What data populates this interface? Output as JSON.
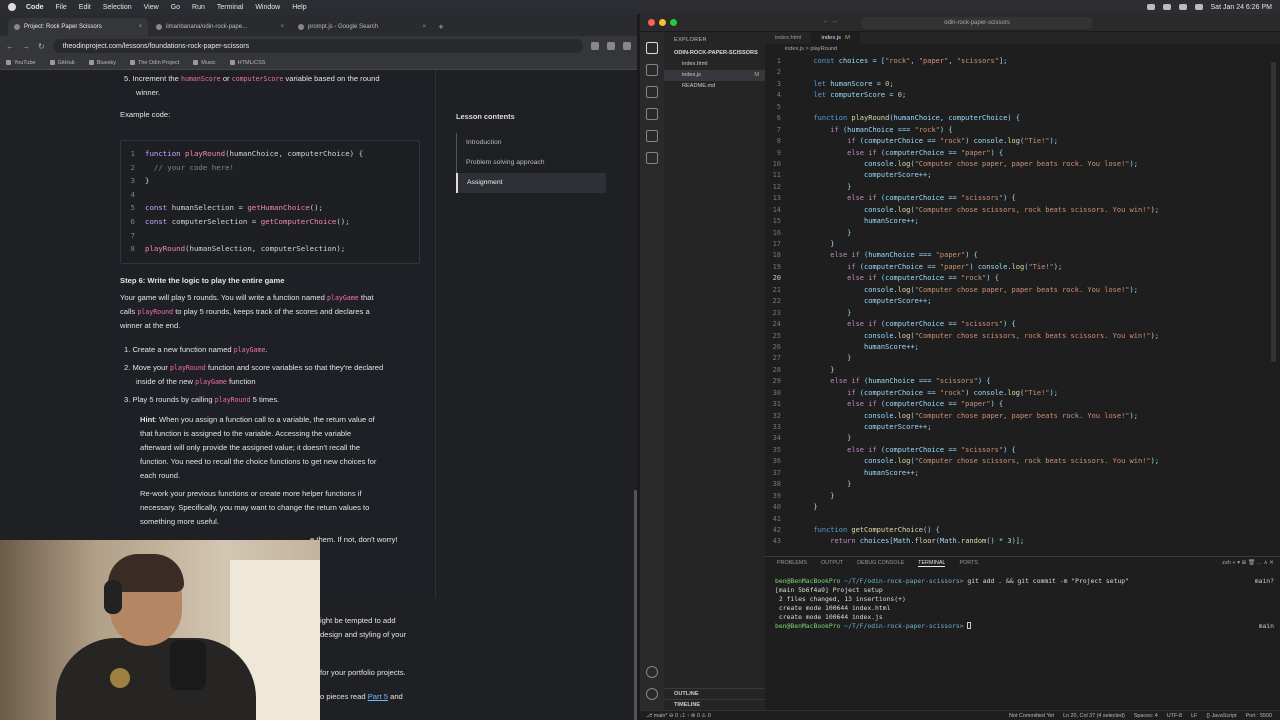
{
  "menubar": {
    "app": "Code",
    "items": [
      "File",
      "Edit",
      "Selection",
      "View",
      "Go",
      "Run",
      "Terminal",
      "Window",
      "Help"
    ],
    "clock": "Sat Jan 24  6:26 PM"
  },
  "browser": {
    "tabs": [
      {
        "label": "Project: Rock Paper Scissors"
      },
      {
        "label": "ilmanbanana/odin-rock-pape..."
      },
      {
        "label": "prompt.js - Google Search"
      }
    ],
    "new_tab": "+",
    "url": "theodinproject.com/lessons/foundations-rock-paper-scissors",
    "bookmarks": [
      "YouTube",
      "GitHub",
      "Bluesky",
      "The Odin Project",
      "Music",
      "HTML/CSS"
    ]
  },
  "article": {
    "step5_item": "5.  Increment the",
    "human_score": "humanScore",
    "or": "or",
    "computer_score": "computerScore",
    "variable_tail": "variable based on the round",
    "winner": "winner.",
    "example_code": "Example code:",
    "code": [
      {
        "n": "1",
        "t": [
          [
            "kw",
            "function "
          ],
          [
            "fn",
            "playRound"
          ],
          [
            "",
            "(humanChoice, computerChoice) {"
          ]
        ]
      },
      {
        "n": "2",
        "t": [
          [
            "cm",
            "  // your code here!"
          ]
        ]
      },
      {
        "n": "3",
        "t": [
          [
            "",
            "}"
          ]
        ]
      },
      {
        "n": "4",
        "t": [
          [
            "",
            ""
          ]
        ]
      },
      {
        "n": "5",
        "t": [
          [
            "kw",
            "const "
          ],
          [
            "",
            "humanSelection = "
          ],
          [
            "fn",
            "getHumanChoice"
          ],
          [
            "",
            "();"
          ]
        ]
      },
      {
        "n": "6",
        "t": [
          [
            "kw",
            "const "
          ],
          [
            "",
            "computerSelection = "
          ],
          [
            "fn",
            "getComputerChoice"
          ],
          [
            "",
            "();"
          ]
        ]
      },
      {
        "n": "7",
        "t": [
          [
            "",
            ""
          ]
        ]
      },
      {
        "n": "8",
        "t": [
          [
            "fn",
            "playRound"
          ],
          [
            "",
            "(humanSelection, computerSelection);"
          ]
        ]
      }
    ],
    "step6": "Step 6: Write the logic to play the entire game",
    "p1a": "Your game will play 5 rounds. You will write a function named",
    "playGame": "playGame",
    "p1b": "that",
    "p1c": "calls",
    "playRound": "playRound",
    "p1d": "to play 5 rounds, keeps track of the scores and declares a",
    "p1e": "winner at the end.",
    "li1a": "1.  Create a new function named",
    "li1b": ".",
    "li2a": "2.  Move your",
    "li2b": "function and score variables so that they're declared",
    "li2c": "inside of the new",
    "li2d": "function",
    "li3a": "3.  Play 5 rounds by calling",
    "li3b": "5 times.",
    "hint_label": "Hint",
    "hint1": ": When you assign a function call to a variable, the return value of",
    "hint2": "that function is assigned to the variable. Accessing the variable",
    "hint3": "afterward will only provide the assigned value; it doesn't recall the",
    "hint4": "function. You need to recall the choice functions to get new choices for",
    "hint5": "each round.",
    "rework1": "Re-work your previous functions or create more helper functions if",
    "rework2": "necessary. Specifically, you may want to change the return values to",
    "rework3": "something more useful.",
    "partial1": "e them. If not, don't worry!",
    "partial2": "ight be tempted to add",
    "partial3": "design and styling of your",
    "partial4": "for your portfolio projects.",
    "partial5": "o pieces read",
    "part5": "Part 5",
    "and": "and"
  },
  "lesson_contents": {
    "title": "Lesson contents",
    "items": [
      "Introduction",
      "Problem solving approach",
      "Assignment"
    ],
    "active": 2
  },
  "vscode": {
    "command_center": "odin-rock-paper-scissors",
    "explorer_title": "EXPLORER",
    "root": "ODIN-ROCK-PAPER-SCISSORS",
    "files": [
      {
        "name": "index.html",
        "mod": ""
      },
      {
        "name": "index.js",
        "mod": "M"
      },
      {
        "name": "README.md",
        "mod": ""
      }
    ],
    "outline": "OUTLINE",
    "timeline": "TIMELINE",
    "editor_tabs": [
      {
        "name": "index.html",
        "mod": ""
      },
      {
        "name": "index.js",
        "mod": "M"
      }
    ],
    "breadcrumb": "index.js > playRound",
    "panel_tabs": [
      "PROBLEMS",
      "OUTPUT",
      "DEBUG CONSOLE",
      "TERMINAL",
      "PORTS"
    ],
    "panel_active": 3,
    "panel_controls": "zsh  +  ▾  ⊞  🗑  …  ∧  ✕",
    "terminal": [
      {
        "p": "ben@BenMacBookPro",
        "d": "~/T/F/odin-rock-paper-scissors",
        "c": "git add . && git commit -m \"Project setup\"",
        "r": "main?"
      },
      {
        "o": "[main 5b6f4a9] Project setup"
      },
      {
        "o": " 2 files changed, 13 insertions(+)"
      },
      {
        "o": " create mode 100644 index.html"
      },
      {
        "o": " create mode 100644 index.js"
      },
      {
        "p": "ben@BenMacBookPro",
        "d": "~/T/F/odin-rock-paper-scissors",
        "c": "",
        "r": "main"
      }
    ],
    "status_left": "⎇ main*  ⊖ 0 ↓1 ↑  ⊗ 0 ⚠ 0",
    "status_right": [
      "Not Committed Yet",
      "Ln 20, Col 37 (4 selected)",
      "Spaces: 4",
      "UTF-8",
      "LF",
      "{} JavaScript",
      "Port : 5500"
    ]
  }
}
